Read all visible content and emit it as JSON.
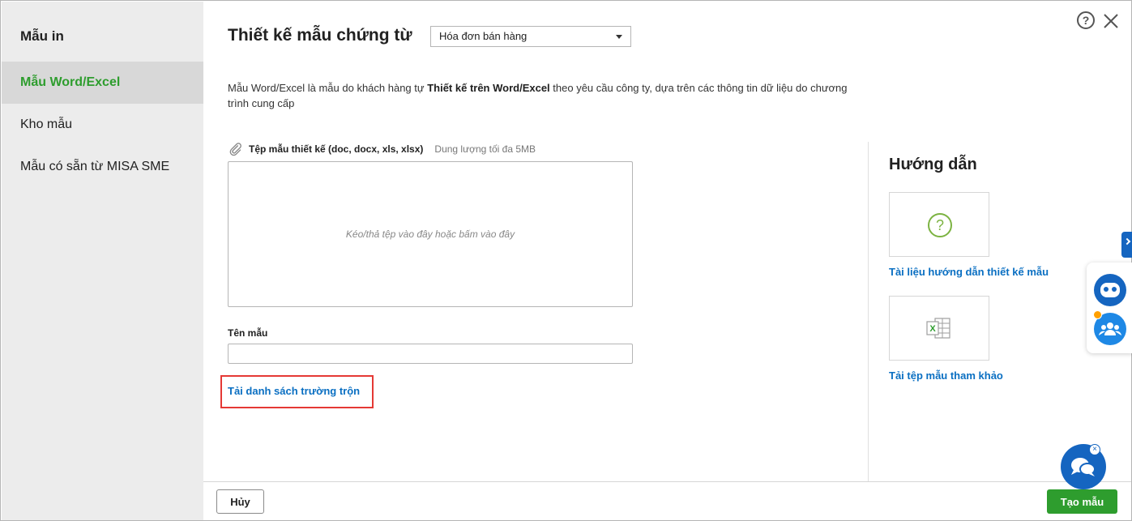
{
  "sidebar": {
    "title": "Mẫu in",
    "items": [
      {
        "label": "Mẫu Word/Excel",
        "active": true
      },
      {
        "label": "Kho mẫu",
        "active": false
      },
      {
        "label": "Mẫu có sẵn từ MISA SME",
        "active": false
      }
    ]
  },
  "header": {
    "title": "Thiết kế mẫu chứng từ",
    "document_type_selected": "Hóa đơn bán hàng",
    "help_icon": "help-circle-icon",
    "close_icon": "close-icon"
  },
  "description": {
    "part1": "Mẫu Word/Excel là mẫu do khách hàng tự ",
    "bold": "Thiết kế trên Word/Excel",
    "part2": " theo yêu cầu công ty, dựa trên các thông tin dữ liệu do chương trình cung cấp"
  },
  "upload": {
    "label": "Tệp mẫu thiết kế (doc, docx, xls, xlsx)",
    "hint": "Dung lượng tối đa 5MB",
    "dropzone_text": "Kéo/thả tệp vào đây hoặc bấm vào đây"
  },
  "template_name": {
    "label": "Tên mẫu",
    "value": "",
    "placeholder": ""
  },
  "download_fields_link": "Tải danh sách trường trộn",
  "guide": {
    "title": "Hướng dẫn",
    "items": [
      {
        "icon": "question-icon",
        "label": "Tài liệu hướng dẫn thiết kế mẫu"
      },
      {
        "icon": "excel-file-icon",
        "label": "Tải tệp mẫu tham khảo"
      }
    ]
  },
  "footer": {
    "cancel_label": "Hủy",
    "create_label": "Tạo mẫu"
  },
  "colors": {
    "accent_green": "#2e9d2e",
    "link_blue": "#0a6fc2",
    "highlight_red": "#e53935",
    "assistant_blue": "#1565c0"
  }
}
